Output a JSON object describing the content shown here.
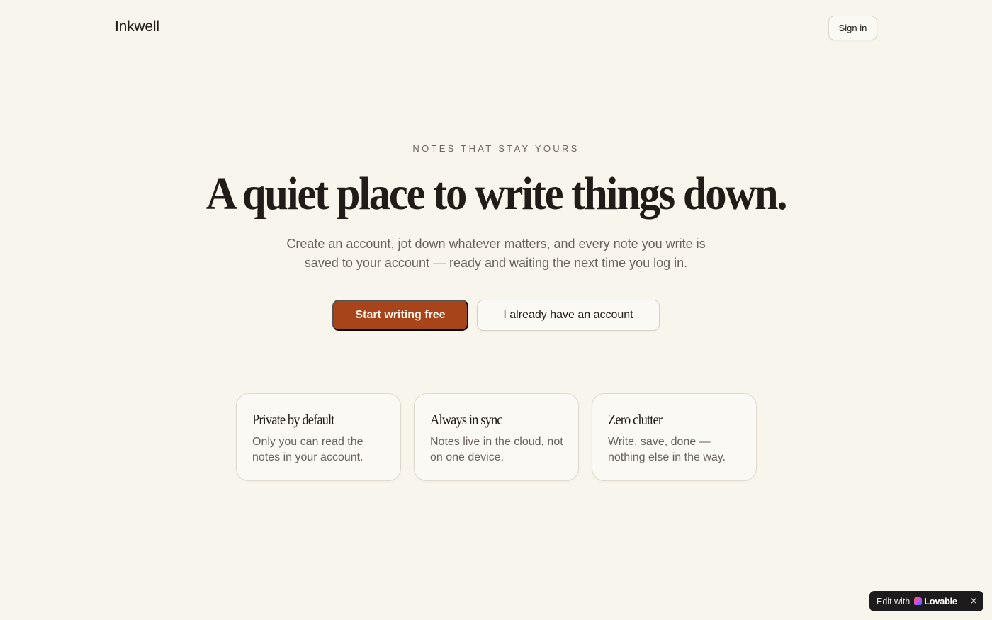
{
  "header": {
    "brand": "Inkwell",
    "sign_in_label": "Sign in"
  },
  "hero": {
    "eyebrow": "NOTES THAT STAY YOURS",
    "headline": "A quiet place to write things down.",
    "subtext": "Create an account, jot down whatever matters, and every note you write is saved to your account — ready and waiting the next time you log in.",
    "primary_cta": "Start writing free",
    "secondary_cta": "I already have an account"
  },
  "features": [
    {
      "title": "Private by default",
      "body": "Only you can read the notes in your account."
    },
    {
      "title": "Always in sync",
      "body": "Notes live in the cloud, not on one device."
    },
    {
      "title": "Zero clutter",
      "body": "Write, save, done — nothing else in the way."
    }
  ],
  "badge": {
    "prefix": "Edit with",
    "brand": "Lovable",
    "close_icon": "close-icon"
  },
  "colors": {
    "background": "#f8f5ec",
    "accent": "#a7441a",
    "text": "#221c18",
    "muted": "#6a625a"
  }
}
